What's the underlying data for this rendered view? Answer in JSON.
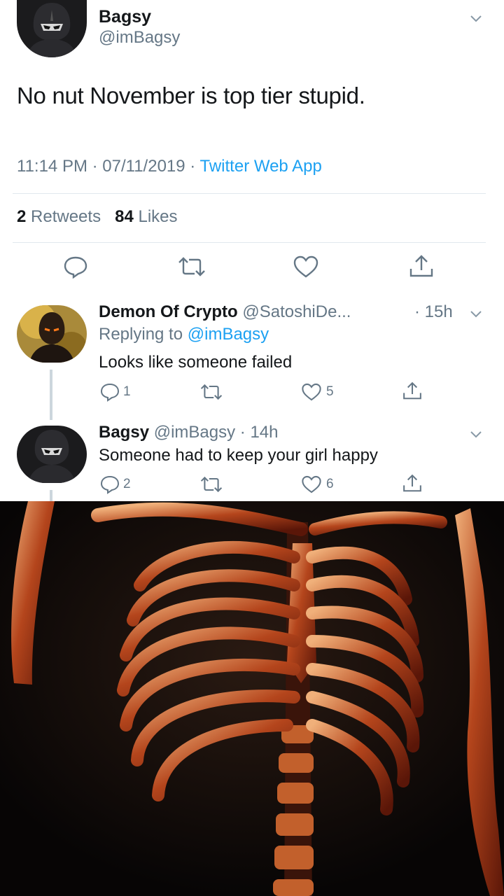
{
  "tweet": {
    "author_name": "Bagsy",
    "author_handle": "@imBagsy",
    "text": "No nut November is top tier stupid.",
    "timestamp": "11:14 PM · 07/11/2019 ·",
    "source": "Twitter Web App",
    "retweets_count": "2",
    "retweets_label": "Retweets",
    "likes_count": "84",
    "likes_label": "Likes"
  },
  "replies": [
    {
      "name": "Demon Of Crypto",
      "handle": "@SatoshiDe...",
      "time": "· 15h",
      "replying_prefix": "Replying to",
      "replying_to": "@imBagsy",
      "text": "Looks like someone failed",
      "reply_count": "1",
      "like_count": "5"
    },
    {
      "name": "Bagsy",
      "handle": "@imBagsy · 14h",
      "text": "Someone had to keep your girl happy",
      "reply_count": "2",
      "like_count": "6"
    }
  ],
  "icons": [
    "reply-icon",
    "retweet-icon",
    "like-icon",
    "share-icon",
    "chevron-down-icon"
  ],
  "colors": {
    "link": "#1da1f2",
    "muted": "#657786",
    "text": "#14171a",
    "divider": "#e1e8ed"
  }
}
